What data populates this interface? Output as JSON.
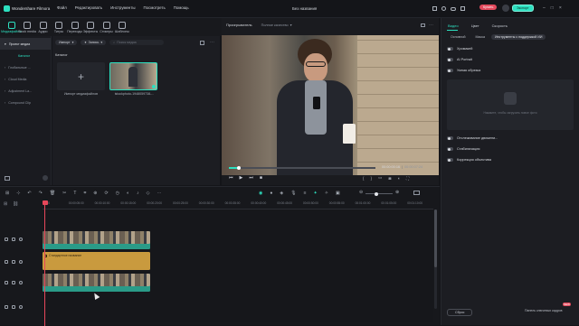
{
  "app": {
    "name": "Wondershare Filmora",
    "project_title": "Без названия"
  },
  "menu": [
    "Файл",
    "Редактировать",
    "Инструменты",
    "Посмотреть",
    "Помощь"
  ],
  "titlebar_buttons": {
    "buy": "Купить",
    "export": "Экспорт"
  },
  "toolbar": [
    {
      "label": "Медиафайлы",
      "icon": "media-icon",
      "active": true
    },
    {
      "label": "Stock media",
      "icon": "stock-icon"
    },
    {
      "label": "Аудио",
      "icon": "audio-icon"
    },
    {
      "label": "Титры",
      "icon": "titles-icon"
    },
    {
      "label": "Переходы",
      "icon": "transitions-icon"
    },
    {
      "label": "Эффекты",
      "icon": "effects-icon"
    },
    {
      "label": "Стикеры",
      "icon": "stickers-icon"
    },
    {
      "label": "Шаблоны",
      "icon": "templates-icon"
    }
  ],
  "leftnav": {
    "project_media": "Проект медиа",
    "folder": "Каталог",
    "items": [
      "Глобальные ...",
      "Cloud Media",
      "Adjustment La...",
      "Compound Clip"
    ]
  },
  "media": {
    "import_label": "Импорт",
    "record_label": "Запись",
    "search_placeholder": "Поиск медиа",
    "folder_label": "Каталог",
    "import_tile_label": "Импорт медиафайлов",
    "clip_label": "istockphoto-1948059738-..."
  },
  "preview": {
    "player_label": "Проигрыватель",
    "quality_label": "Полное качество",
    "current_time": "00:00:00:16",
    "total_time": "00:00:07:24",
    "progress": 0.07
  },
  "props": {
    "tabs": [
      "Видео",
      "Цвет",
      "Скорость"
    ],
    "subtabs": [
      "Основной",
      "Маска",
      "Инструменты с поддержкой ИИ"
    ],
    "items_top": [
      "Хромакей",
      "AI Portrait",
      "Умная обрезка"
    ],
    "placeholder_text": "Нажмите, чтобы загрузить новое фото",
    "items_bottom": [
      "Отслеживание движени...",
      "Стабилизация",
      "Коррекция объектива"
    ],
    "reset_label": "Сброс",
    "keyframe_label": "Панель ключевых кадров",
    "keyframe_badge": "NEW"
  },
  "timeline": {
    "ruler": [
      "00:00",
      "00:00:05:00",
      "00:00:10:00",
      "00:00:15:00",
      "00:00:20:00",
      "00:00:25:00",
      "00:00:30:00",
      "00:00:35:00",
      "00:00:40:00",
      "00:00:45:00",
      "00:00:50:00",
      "00:00:55:00",
      "00:01:00:00",
      "00:01:05:00",
      "00:01:10:00"
    ],
    "title_clip_label": "Стандартное название",
    "colors": {
      "video_clip": "#2a9b88",
      "title_clip": "#c99a3e",
      "playhead": "#e8475a",
      "accent": "#2de0c0"
    }
  }
}
